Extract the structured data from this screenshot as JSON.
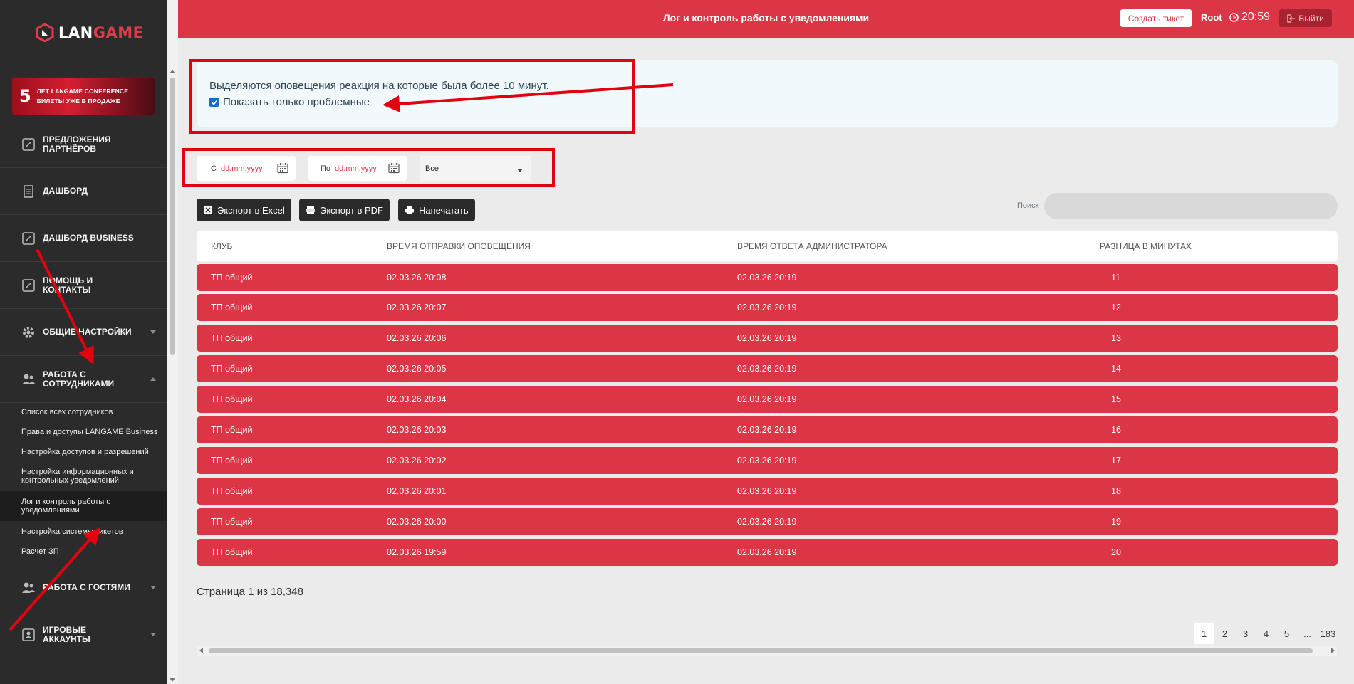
{
  "brand": {
    "logo_prefix": "LAN",
    "logo_suffix": "GAME"
  },
  "promo": {
    "number": "5",
    "line1": "ЛЕТ LANGAME CONFERENCE",
    "line2": "БИЛЕТЫ УЖЕ В ПРОДАЖЕ"
  },
  "sidebar": {
    "items": [
      {
        "label": "Предложения партнёров",
        "icon": "edit-icon"
      },
      {
        "label": "Дашборд",
        "icon": "document-icon"
      },
      {
        "label": "Дашборд Business",
        "icon": "edit-icon"
      },
      {
        "label": "Помощь и контакты",
        "icon": "edit-icon"
      },
      {
        "label": "Общие настройки",
        "icon": "gear-icon"
      },
      {
        "label": "Работа с сотрудниками",
        "icon": "users-icon"
      }
    ],
    "submenu": [
      "Список всех сотрудников",
      "Права и доступы LANGAME Business",
      "Настройка доступов и разрешений",
      "Настройка информационных и контрольных уведомлений",
      "Лог и контроль работы с уведомлениями",
      "Настройка системы тикетов",
      "Расчет ЗП"
    ],
    "items_after": [
      {
        "label": "Работа с гостями",
        "icon": "users-icon"
      },
      {
        "label": "Игровые аккаунты",
        "icon": "account-icon"
      }
    ]
  },
  "header": {
    "title": "Лог и контроль работы с уведомлениями",
    "create_ticket": "Создать тикет",
    "user": "Root",
    "time": "20:59",
    "logout": "Выйти"
  },
  "info": {
    "text": "Выделяются оповещения реакция на которые была более 10 минут.",
    "checkbox_label": "Показать только проблемные",
    "checkbox_checked": true
  },
  "filters": {
    "from_prefix": "С",
    "from_placeholder": "dd.mm.yyyy",
    "to_prefix": "По",
    "to_placeholder": "dd.mm.yyyy",
    "select_value": "Все"
  },
  "actions": {
    "excel": "Экспорт в Excel",
    "pdf": "Экспорт в PDF",
    "print": "Напечатать",
    "search_label": "Поиск"
  },
  "table": {
    "headers": [
      "Клуб",
      "Время отправки оповещения",
      "Время ответа администратора",
      "Разница в минутах"
    ],
    "rows": [
      [
        "ТП общий",
        "02.03.26 20:08",
        "02.03.26 20:19",
        "11"
      ],
      [
        "ТП общий",
        "02.03.26 20:07",
        "02.03.26 20:19",
        "12"
      ],
      [
        "ТП общий",
        "02.03.26 20:06",
        "02.03.26 20:19",
        "13"
      ],
      [
        "ТП общий",
        "02.03.26 20:05",
        "02.03.26 20:19",
        "14"
      ],
      [
        "ТП общий",
        "02.03.26 20:04",
        "02.03.26 20:19",
        "15"
      ],
      [
        "ТП общий",
        "02.03.26 20:03",
        "02.03.26 20:19",
        "16"
      ],
      [
        "ТП общий",
        "02.03.26 20:02",
        "02.03.26 20:19",
        "17"
      ],
      [
        "ТП общий",
        "02.03.26 20:01",
        "02.03.26 20:19",
        "18"
      ],
      [
        "ТП общий",
        "02.03.26 20:00",
        "02.03.26 20:19",
        "19"
      ],
      [
        "ТП общий",
        "02.03.26 19:59",
        "02.03.26 20:19",
        "20"
      ]
    ]
  },
  "pagination": {
    "info": "Страница 1 из 18,348",
    "pages": [
      "1",
      "2",
      "3",
      "4",
      "5",
      "...",
      "183"
    ]
  },
  "colors": {
    "accent": "#dc3545",
    "sidebar": "#2b2b2b",
    "annotation": "#e3000f"
  }
}
